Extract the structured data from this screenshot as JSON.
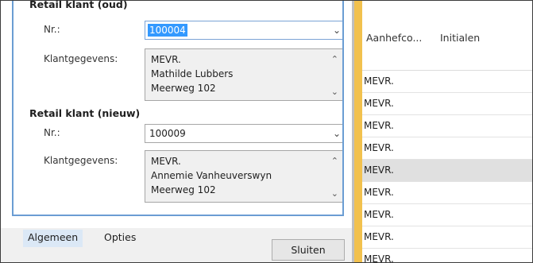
{
  "old_customer": {
    "title": "Retail klant (oud)",
    "nr_label": "Nr.:",
    "nr_value": "100004",
    "details_label": "Klantgegevens:",
    "details_lines": [
      "MEVR.",
      "Mathilde Lubbers",
      "Meerweg 102"
    ]
  },
  "new_customer": {
    "title": "Retail klant (nieuw)",
    "nr_label": "Nr.:",
    "nr_value": "100009",
    "details_label": "Klantgegevens:",
    "details_lines": [
      "MEVR.",
      "Annemie Vanheuverswyn",
      "Meerweg 102"
    ]
  },
  "tabs": [
    "Algemeen",
    "Opties"
  ],
  "close_button": "Sluiten",
  "grid": {
    "columns": [
      "Aanhefco...",
      "Initialen"
    ],
    "rows": [
      "MEVR.",
      "MEVR.",
      "MEVR.",
      "MEVR.",
      "MEVR.",
      "MEVR.",
      "MEVR.",
      "MEVR.",
      "MEVR."
    ],
    "selected_row_index": 4
  },
  "colors": {
    "accent_border": "#6b9dd3",
    "selection": "#3399ff",
    "splitter_accent": "#f2c14e"
  }
}
